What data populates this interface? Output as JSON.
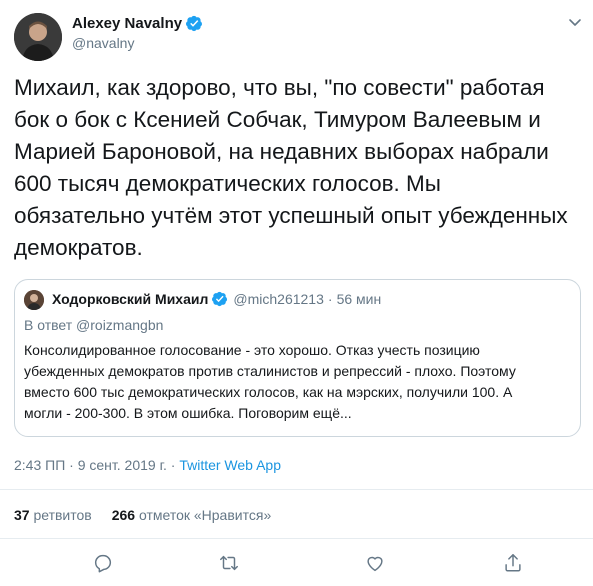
{
  "author": {
    "name": "Alexey Navalny",
    "handle": "@navalny"
  },
  "tweet_text": "Михаил, как здорово, что вы, \"по совести\" работая\nбок о бок с Ксенией Собчак, Тимуром Валеевым и\nМарией Бароновой, на недавних выборах набрали\n600 тысяч демократических голосов. Мы\nобязательно учтём этот успешный опыт убежденных\nдемократов.",
  "quoted": {
    "name": "Ходорковский Михаил",
    "handle": "@mich261213",
    "dot": "·",
    "time": "56 мин",
    "reply_prefix": "В ответ ",
    "reply_to": "@roizmangbn",
    "text": "Консолидированное голосование - это хорошо. Отказ учесть позицию\nубежденных демократов против сталинистов и репрессий - плохо. Поэтому\nвместо 600 тыс демократических голосов, как на мэрских, получили 100. А\nмогли - 200-300. В этом ошибка. Поговорим ещё..."
  },
  "meta": {
    "datetime": "2:43 ПП · 9 сент. 2019 г. · ",
    "app": "Twitter Web App"
  },
  "stats": {
    "retweets_count": "37",
    "retweets_label": "ретвитов",
    "likes_count": "266",
    "likes_label": "отметок «Нравится»"
  },
  "icons": {
    "verified": "verified-badge-icon",
    "chevron": "chevron-down-icon",
    "reply": "reply-icon",
    "retweet": "retweet-icon",
    "like": "heart-icon",
    "share": "share-icon"
  },
  "colors": {
    "accent": "#1da1f2",
    "link": "#1b95e0",
    "muted": "#657786",
    "border": "#ccd6dd"
  }
}
